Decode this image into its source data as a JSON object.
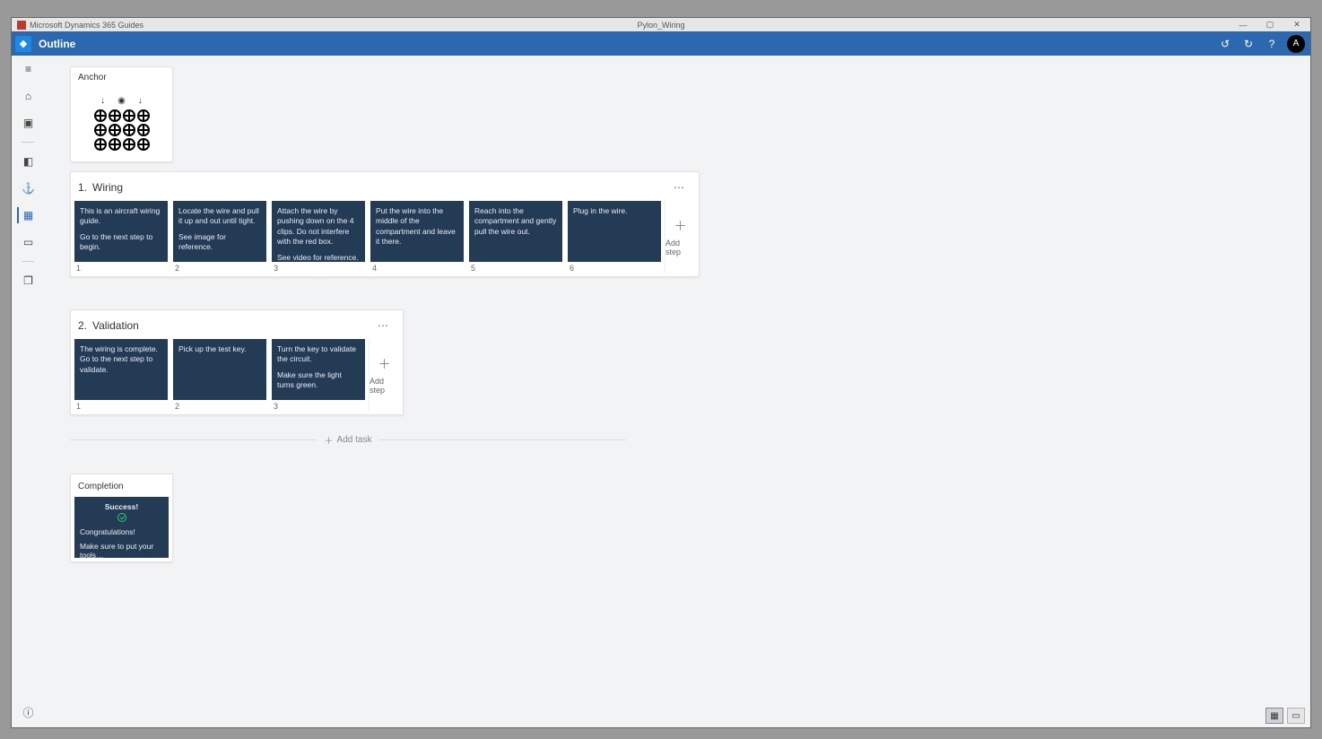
{
  "titlebar": {
    "app_name": "Microsoft Dynamics 365 Guides",
    "document_name": "Pylon_Wiring"
  },
  "ribbon": {
    "page_title": "Outline",
    "undo_label": "Undo",
    "redo_label": "Redo",
    "help_label": "?",
    "avatar_initial": "A"
  },
  "anchor": {
    "title": "Anchor"
  },
  "tasks": [
    {
      "number": "1.",
      "name": "Wiring",
      "add_step_label": "Add step",
      "steps": [
        {
          "idx": "1",
          "line1": "This is an aircraft wiring guide.",
          "line2": "Go to the next step to begin."
        },
        {
          "idx": "2",
          "line1": "Locate the wire and pull it up and out until tight.",
          "line2": "See image for reference."
        },
        {
          "idx": "3",
          "line1": "Attach the wire by pushing down on the 4 clips.  Do not interfere with the red box.",
          "line2": "See video for reference."
        },
        {
          "idx": "4",
          "line1": "Put the wire into the middle of the compartment and leave it there.",
          "line2": ""
        },
        {
          "idx": "5",
          "line1": "Reach into the compartment and gently pull the wire out.",
          "line2": ""
        },
        {
          "idx": "6",
          "line1": "Plug in the wire.",
          "line2": ""
        }
      ]
    },
    {
      "number": "2.",
      "name": "Validation",
      "add_step_label": "Add step",
      "steps": [
        {
          "idx": "1",
          "line1": "The wiring is complete. Go to the next step to validate.",
          "line2": ""
        },
        {
          "idx": "2",
          "line1": "Pick up the test key.",
          "line2": ""
        },
        {
          "idx": "3",
          "line1": "Turn the key to validate the circuit.",
          "line2": "Make sure the light turns green."
        }
      ]
    }
  ],
  "add_task_label": "Add task",
  "completion": {
    "title": "Completion",
    "success": "Success!",
    "congrats": "Congratulations!",
    "note": "Make sure to put your tools…"
  }
}
